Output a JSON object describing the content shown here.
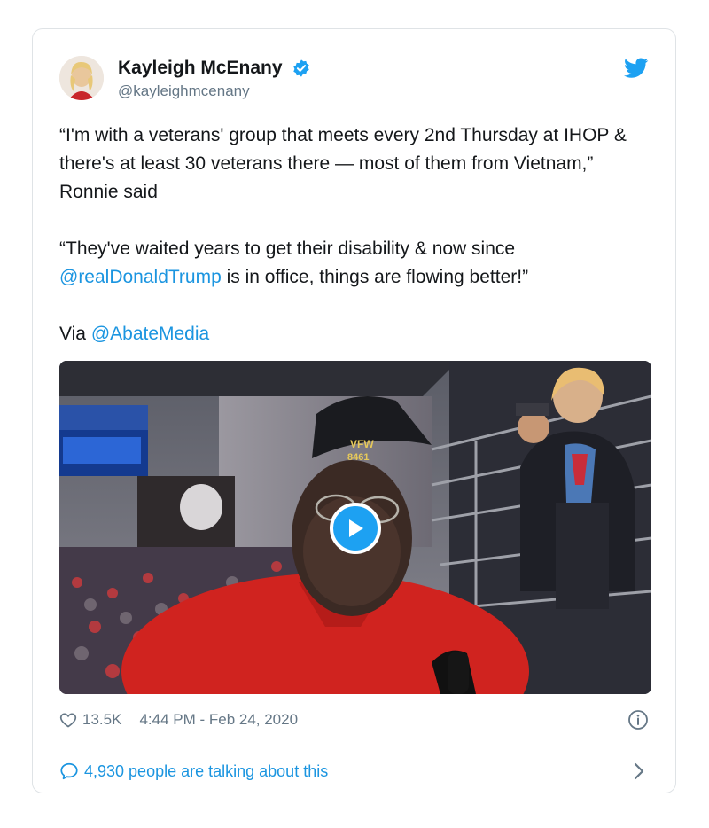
{
  "tweet": {
    "author_name": "Kayleigh McEnany",
    "handle": "@kayleighmcenany",
    "paragraph1": "“I'm with a veterans' group that meets every 2nd Thursday at IHOP & there's at least 30 veterans there — most of them from Vietnam,” Ronnie said",
    "paragraph2_part1": "“They've waited years to get their disability & now since ",
    "paragraph2_mention": "@realDonaldTrump",
    "paragraph2_part2": " is in office, things are flowing better!”",
    "via_label": "Via ",
    "via_mention": "@AbateMedia",
    "likes": "13.5K",
    "timestamp": "4:44 PM - Feb 24, 2020",
    "talking": "4,930 people are talking about this"
  },
  "icons": {
    "verified": "verified-badge-icon",
    "bird": "twitter-bird-icon",
    "play": "play-icon",
    "heart": "heart-icon",
    "info": "info-icon",
    "bubble": "speech-bubble-icon",
    "chevron": "chevron-right-icon"
  },
  "colors": {
    "link": "#1b95e0",
    "brand": "#1da1f2",
    "muted": "#657786",
    "video_shirt": "#d0231f"
  }
}
